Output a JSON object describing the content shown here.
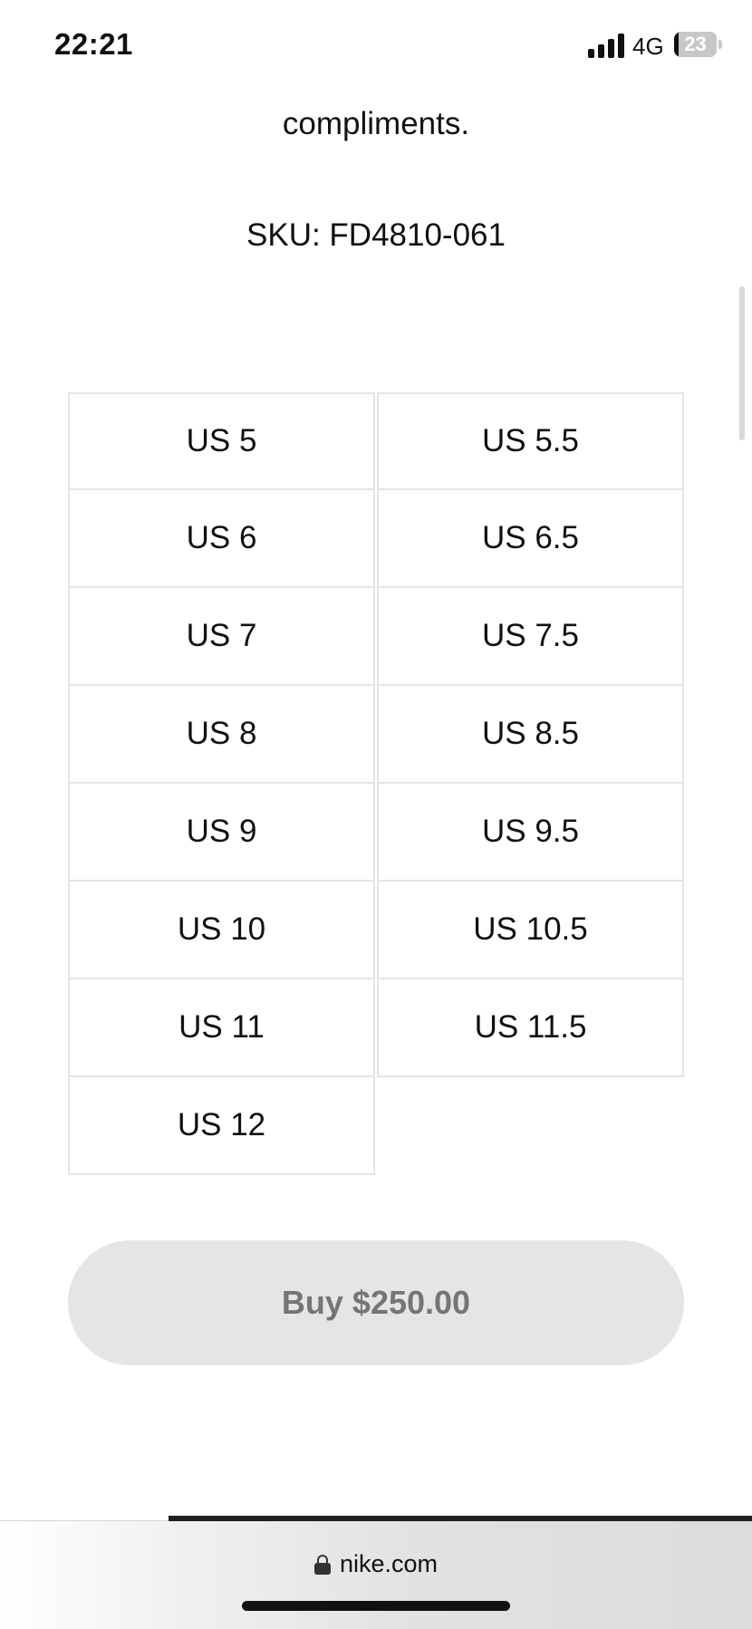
{
  "status_bar": {
    "time": "22:21",
    "network": "4G",
    "battery": "23",
    "signal_bars": 4
  },
  "description_tail": "compliments.",
  "sku": "SKU: FD4810-061",
  "sizes": [
    "US 5",
    "US 5.5",
    "US 6",
    "US 6.5",
    "US 7",
    "US 7.5",
    "US 8",
    "US 8.5",
    "US 9",
    "US 9.5",
    "US 10",
    "US 10.5",
    "US 11",
    "US 11.5",
    "US 12"
  ],
  "buy_button": {
    "label": "Buy $250.00"
  },
  "browser": {
    "url": "nike.com"
  },
  "colors": {
    "cell_border": "#e5e5e5",
    "button_bg": "#e5e5e5",
    "button_text": "#757575",
    "text": "#111111"
  },
  "icons": [
    "signal-icon",
    "battery-icon",
    "lock-icon"
  ]
}
